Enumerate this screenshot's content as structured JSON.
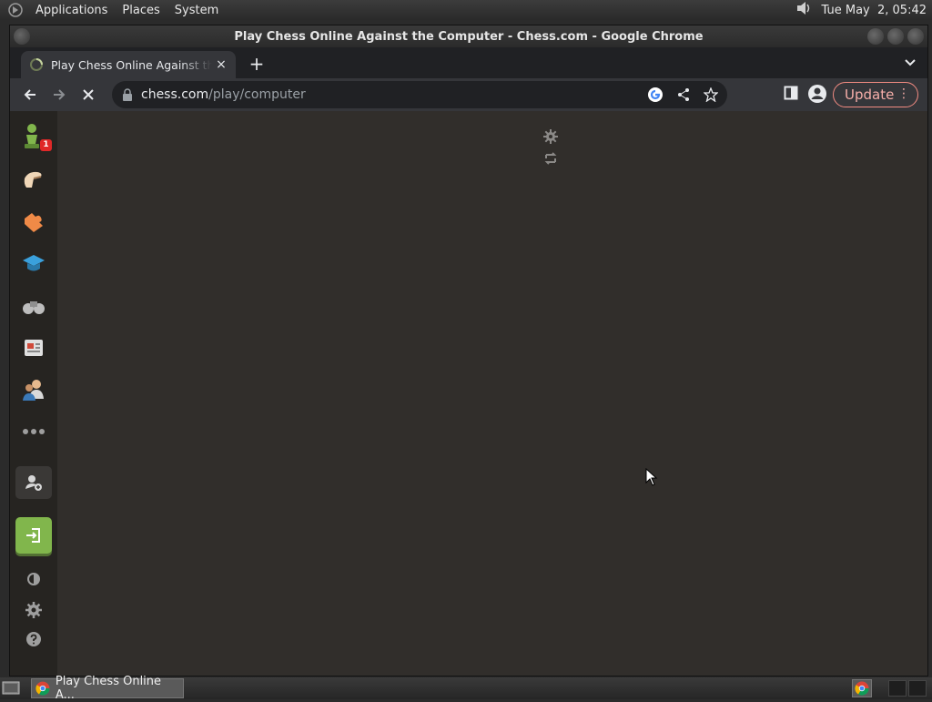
{
  "top_panel": {
    "menus": [
      "Applications",
      "Places",
      "System"
    ],
    "clock": "Tue May  2, 05:42"
  },
  "window": {
    "title": "Play Chess Online Against the Computer - Chess.com - Google Chrome"
  },
  "tab": {
    "title": "Play Chess Online Against the Computer - Chess.com",
    "close_glyph": "×",
    "new_tab_glyph": "+"
  },
  "toolbar": {
    "url_host": "chess.com",
    "url_path": "/play/computer",
    "update_label": "Update"
  },
  "sidebar": {
    "items": [
      "play-icon",
      "puzzles-icon",
      "learn-icon",
      "lessons-icon",
      "watch-icon",
      "news-icon",
      "social-icon",
      "more-icon"
    ],
    "badge_count": "1"
  },
  "taskbar": {
    "task_label": "Play Chess Online A..."
  },
  "colors": {
    "content_bg": "#312e2b",
    "sidebar_bg": "#262421",
    "login_green": "#81b64c",
    "update_border": "#f28b82"
  }
}
